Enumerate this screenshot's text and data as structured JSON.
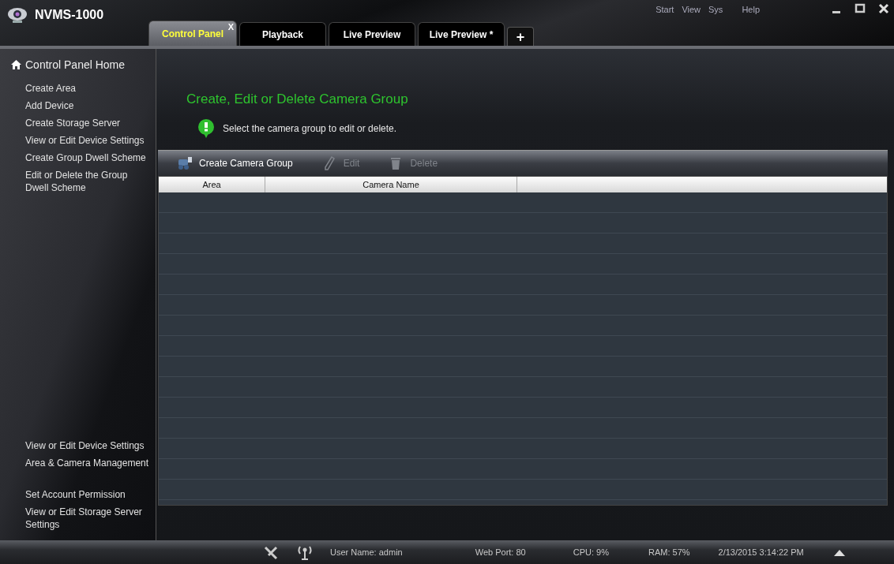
{
  "app": {
    "title": "NVMS-1000"
  },
  "menu": [
    "Start",
    "View",
    "Sys",
    "Help"
  ],
  "tabs": [
    {
      "label": "Control Panel",
      "selected": true,
      "close": "X"
    },
    {
      "label": "Playback",
      "selected": false
    },
    {
      "label": "Live Preview",
      "selected": false
    },
    {
      "label": "Live Preview *",
      "selected": false
    }
  ],
  "new_tab": "+",
  "sidebar": {
    "home": "Control Panel Home",
    "groups": [
      [
        "Create Area",
        "Add Device",
        "Create Storage Server",
        "View or Edit Device Settings",
        "Create Group Dwell Scheme",
        "Edit or Delete the Group Dwell Scheme"
      ],
      [
        "View or Edit Device Settings",
        "Area & Camera Management"
      ],
      [
        "Set Account Permission",
        "View or Edit Storage Server Settings"
      ]
    ]
  },
  "main": {
    "heading": "Create, Edit or Delete Camera Group",
    "hint": "Select the camera group to edit or delete.",
    "toolbar": [
      {
        "kind": "create",
        "label": "Create Camera Group",
        "disabled": false
      },
      {
        "kind": "edit",
        "label": "Edit",
        "disabled": true
      },
      {
        "kind": "delete",
        "label": "Delete",
        "disabled": true
      }
    ],
    "table": {
      "columns": [
        "Area",
        "Camera Name"
      ]
    }
  },
  "status_bar": {
    "user": "User Name: admin",
    "port": "Web Port: 80",
    "cpu": "CPU: 9%",
    "ram": "RAM: 57%",
    "datetime": "2/13/2015 3:14:22 PM"
  }
}
